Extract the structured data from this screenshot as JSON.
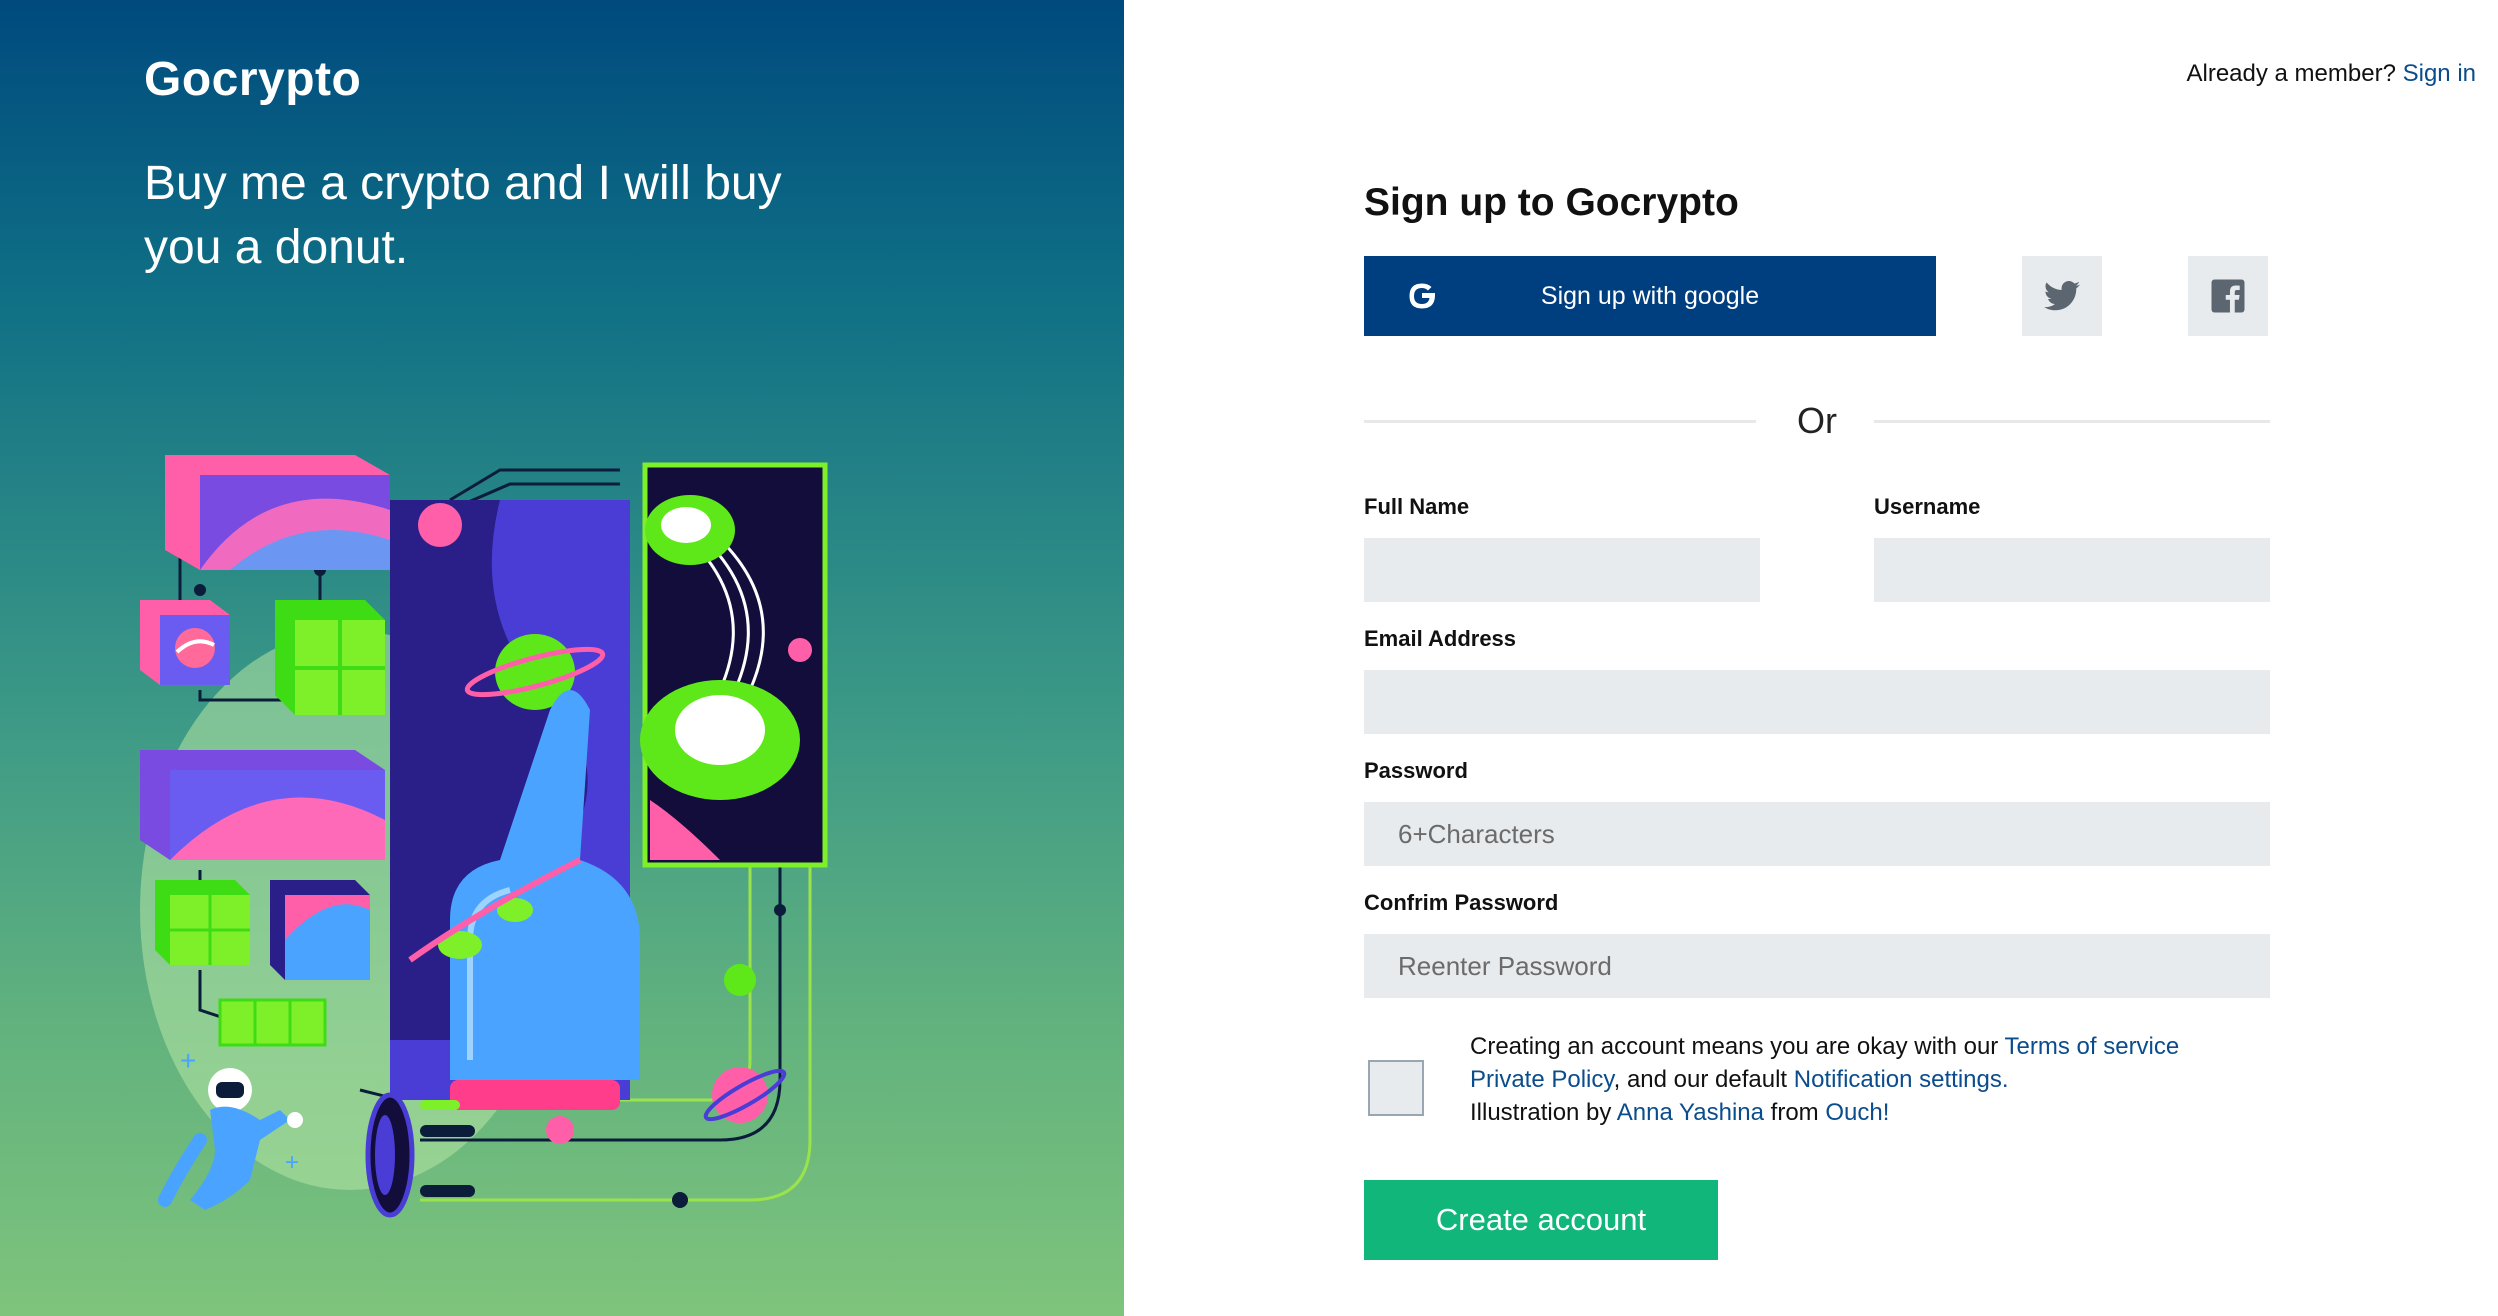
{
  "brand": {
    "name": "Gocrypto"
  },
  "hero": {
    "tagline": "Buy me a crypto and I will buy you a donut."
  },
  "header": {
    "already_member": "Already a member?",
    "sign_in": "Sign in"
  },
  "form": {
    "title": "Sign up to Gocrypto",
    "google_button": "Sign up with google",
    "twitter_icon": "twitter-icon",
    "facebook_icon": "facebook-icon",
    "divider": "Or",
    "full_name": {
      "label": "Full Name",
      "value": "",
      "placeholder": ""
    },
    "username": {
      "label": "Username",
      "value": "",
      "placeholder": ""
    },
    "email": {
      "label": "Email Address",
      "value": "",
      "placeholder": ""
    },
    "password": {
      "label": "Password",
      "value": "",
      "placeholder": "6+Characters"
    },
    "confirm_password": {
      "label": "Confrim Password",
      "value": "",
      "placeholder": "Reenter Password"
    },
    "terms": {
      "checked": false,
      "line1_prefix": "Creating an account means you are okay with our",
      "terms_link": "Terms of service",
      "privacy_link": "Private Policy",
      "line2_middle": ", and our default",
      "notification_link": "Notification settings.",
      "line3_prefix": "Illustration by",
      "author_link": "Anna Yashina",
      "from": "from",
      "source_link": "Ouch!"
    },
    "submit": "Create account"
  },
  "colors": {
    "primary": "#003f7f",
    "success": "#10b67a",
    "link": "#0a4c8c",
    "input_bg": "#e8ebee",
    "hero_top": "#004a7e",
    "hero_bottom": "#7ec47c"
  }
}
